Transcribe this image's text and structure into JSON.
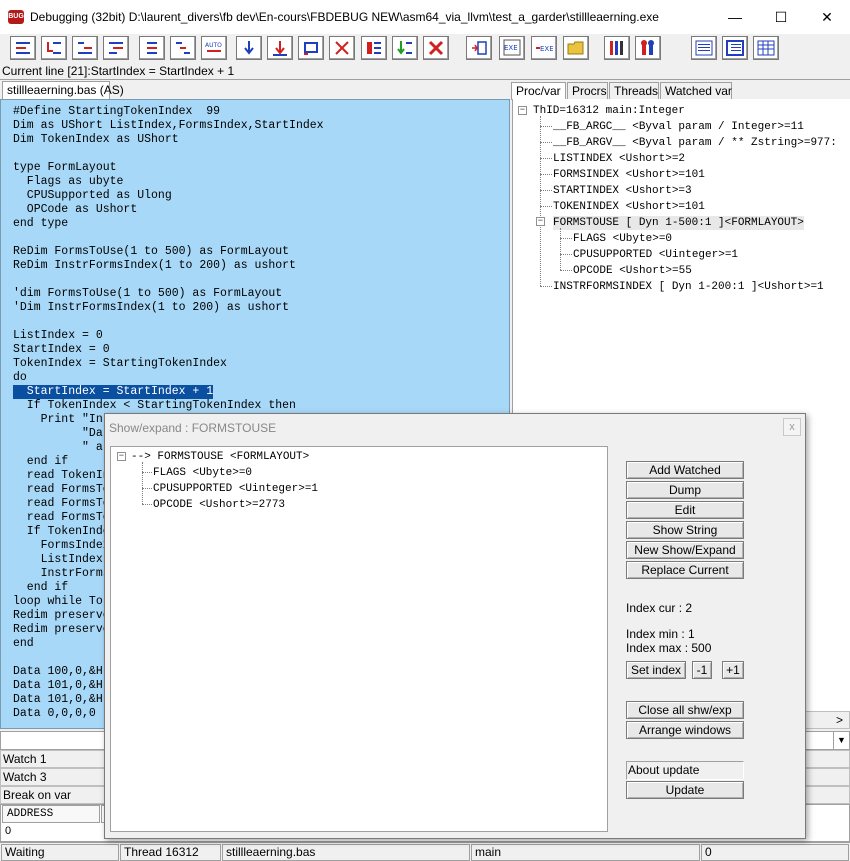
{
  "window": {
    "title": "Debugging (32bit) D:\\laurent_divers\\fb dev\\En-cours\\FBDEBUG NEW\\asm64_via_llvm\\test_a_garder\\stillleaerning.exe",
    "icon_label": "BUG",
    "minimize": "—",
    "maximize": "☐",
    "close": "✕"
  },
  "current_line": "Current line [21]:StartIndex = StartIndex + 1",
  "source_tab": "stillleaerning.bas (AS)",
  "right_tabs": [
    "Proc/var",
    "Procrs",
    "Threads",
    "Watched var"
  ],
  "source_lines": [
    "#Define StartingTokenIndex  99",
    "Dim as UShort ListIndex,FormsIndex,StartIndex",
    "Dim TokenIndex as UShort",
    "",
    "type FormLayout",
    "  Flags as ubyte",
    "  CPUSupported as Ulong",
    "  OPCode as Ushort",
    "end type",
    "",
    "ReDim FormsToUse(1 to 500) as FormLayout",
    "ReDim InstrFormsIndex(1 to 200) as ushort",
    "",
    "'dim FormsToUse(1 to 500) as FormLayout",
    "'Dim InstrFormsIndex(1 to 200) as ushort",
    "",
    "ListIndex = 0",
    "StartIndex = 0",
    "TokenIndex = StartingTokenIndex",
    "do",
    "  StartIndex = StartIndex + 1",
    "  If TokenIndex < StartingTokenIndex then",
    "    Print \"In",
    "          \"Da",
    "          \" a",
    "  end if",
    "  read TokenIn",
    "  read FormsTo",
    "  read FormsTo",
    "  read FormsTo",
    "  If TokenInde",
    "    FormsIndex",
    "    ListIndex",
    "    InstrForms",
    "  end if",
    "loop while To",
    "Redim preserve",
    "Redim preserve",
    "end",
    "",
    "Data 100,0,&H",
    "Data 101,0,&H",
    "Data 101,0,&H",
    "Data 0,0,0,0"
  ],
  "tree": [
    "ThID=16312 main:Integer",
    "__FB_ARGC__ <Byval param / Integer>=11",
    "__FB_ARGV__ <Byval param / ** Zstring>=977:",
    "LISTINDEX <Ushort>=2",
    "FORMSINDEX <Ushort>=101",
    "STARTINDEX <Ushort>=3",
    "TOKENINDEX <Ushort>=101",
    "FORMSTOUSE [ Dyn 1-500:1 ]<FORMLAYOUT>",
    "FLAGS <Ubyte>=0",
    "CPUSUPPORTED <Uinteger>=1",
    "OPCODE <Ushort>=55",
    "INSTRFORMSINDEX [ Dyn 1-200:1 ]<Ushort>=1"
  ],
  "lower": {
    "watch1": "Watch 1",
    "watch3": "Watch 3",
    "break_on_var": "Break on var",
    "address_header": "ADDRESS",
    "address_value": "0"
  },
  "status": {
    "state": "Waiting",
    "thread": "Thread 16312",
    "file": "stillleaerning.bas",
    "proc": "main",
    "line": "0"
  },
  "dialog": {
    "title": "Show/expand : FORMSTOUSE",
    "close": "x",
    "tree": [
      "--> FORMSTOUSE <FORMLAYOUT>",
      "FLAGS <Ubyte>=0",
      "CPUSUPPORTED <Uinteger>=1",
      "OPCODE <Ushort>=2773"
    ],
    "buttons": {
      "add_watched": "Add Watched",
      "dump": "Dump",
      "edit": "Edit",
      "show_string": "Show String",
      "new_show_expand": "New Show/Expand",
      "replace_current": "Replace Current",
      "set_index": "Set index",
      "minus_one": "-1",
      "plus_one": "+1",
      "close_all": "Close all shw/exp",
      "arrange": "Arrange windows",
      "update": "Update"
    },
    "index_cur": "Index cur : 2",
    "index_min": "Index min : 1",
    "index_max": "Index max : 500",
    "about_update": "About update"
  },
  "colors": {
    "source_bg": "#a8d8f8",
    "current_line_bg": "#0a4fa0",
    "toolbar_red": "#d21f1f",
    "toolbar_blue": "#1f3fbf"
  }
}
